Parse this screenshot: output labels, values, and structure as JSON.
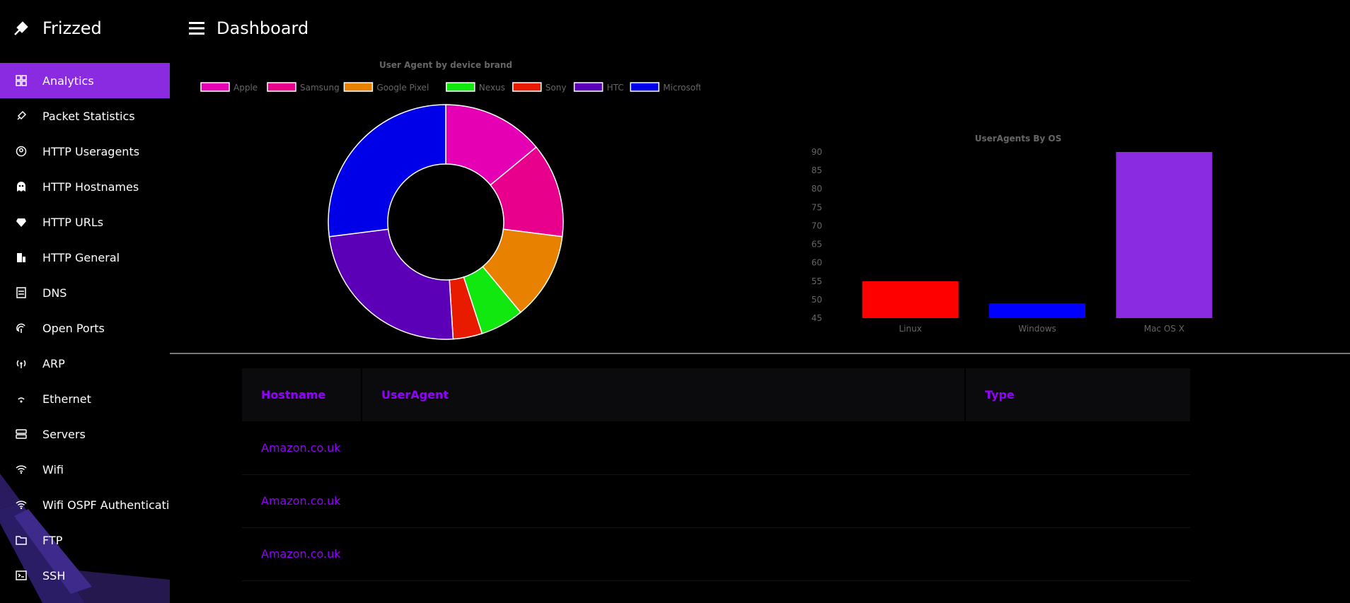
{
  "app": {
    "title": "Frizzed",
    "brand_icon": "rocket-icon"
  },
  "header": {
    "title": "Dashboard",
    "menu_icon": "hamburger-menu-icon"
  },
  "sidebar": {
    "items": [
      {
        "label": "Analytics",
        "icon": "grid-icon",
        "active": true
      },
      {
        "label": "Packet Statistics",
        "icon": "rocket-icon"
      },
      {
        "label": "HTTP Useragents",
        "icon": "user-circle-icon"
      },
      {
        "label": "HTTP Hostnames",
        "icon": "ghost-icon"
      },
      {
        "label": "HTTP URLs",
        "icon": "diamond-icon"
      },
      {
        "label": "HTTP General",
        "icon": "building-icon"
      },
      {
        "label": "DNS",
        "icon": "server-list-icon"
      },
      {
        "label": "Open Ports",
        "icon": "fingerprint-icon"
      },
      {
        "label": "ARP",
        "icon": "broadcast-icon"
      },
      {
        "label": "Ethernet",
        "icon": "signal-icon"
      },
      {
        "label": "Servers",
        "icon": "server-icon"
      },
      {
        "label": "Wifi",
        "icon": "wifi-icon"
      },
      {
        "label": "Wifi OSPF Authentication",
        "icon": "wifi-icon"
      },
      {
        "label": "FTP",
        "icon": "folder-icon"
      },
      {
        "label": "SSH",
        "icon": "terminal-icon"
      }
    ]
  },
  "chart_data": [
    {
      "type": "pie",
      "title": "User Agent by device brand",
      "categories": [
        "Apple",
        "Samsung",
        "Google Pixel",
        "Nexus",
        "Sony",
        "HTC",
        "Microsoft"
      ],
      "values": [
        14,
        13,
        12,
        6,
        4,
        24,
        27
      ],
      "colors": [
        "#e600b4",
        "#e8008c",
        "#e88000",
        "#10e810",
        "#e81a00",
        "#5c00b8",
        "#0000e8"
      ],
      "legend": "top"
    },
    {
      "type": "bar",
      "title": "UserAgents By OS",
      "categories": [
        "Linux",
        "Windows",
        "Mac OS X"
      ],
      "values": [
        55,
        49,
        90
      ],
      "colors": [
        "#ff0000",
        "#0000ff",
        "#8a2be2"
      ],
      "ylim": [
        45,
        90
      ],
      "yticks": [
        45,
        50,
        55,
        60,
        65,
        70,
        75,
        80,
        85,
        90
      ],
      "grid": false,
      "legend": "none"
    }
  ],
  "table": {
    "headers": [
      "Hostname",
      "UserAgent",
      "Type"
    ],
    "rows": [
      [
        "Amazon.co.uk",
        "",
        ""
      ],
      [
        "Amazon.co.uk",
        "",
        ""
      ],
      [
        "Amazon.co.uk",
        "",
        ""
      ]
    ]
  }
}
